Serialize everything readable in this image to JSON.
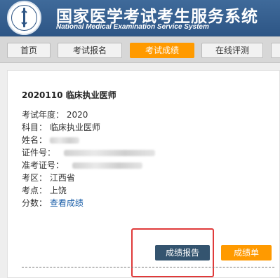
{
  "header": {
    "title": "国家医学考试考生服务系统",
    "subtitle": "National Medical Examination Service System",
    "logo_icon": "medical-caduceus-emblem"
  },
  "nav": {
    "items": [
      {
        "label": "首页",
        "active": false
      },
      {
        "label": "考试报名",
        "active": false
      },
      {
        "label": "考试成绩",
        "active": true
      },
      {
        "label": "在线评测",
        "active": false
      }
    ]
  },
  "result": {
    "title": "2020110   临床执业医师",
    "year_label": "考试年度：",
    "year": "2020",
    "subject_label": "科目：",
    "subject": "临床执业医师",
    "name_label": "姓名：",
    "id_label": "证件号：",
    "ticket_label": "准考证号：",
    "region_label": "考区：",
    "region": "江西省",
    "site_label": "考点：",
    "site": "上饶",
    "score_label": "分数：",
    "score_link": "查看成绩"
  },
  "actions": {
    "report_label": "成绩报告",
    "score_sheet_label": "成绩单"
  },
  "colors": {
    "header_bg": "#2d5585",
    "accent": "#ff9a00",
    "report_button": "#34546f",
    "highlight": "#e03a3a",
    "link": "#1a5ea8"
  }
}
